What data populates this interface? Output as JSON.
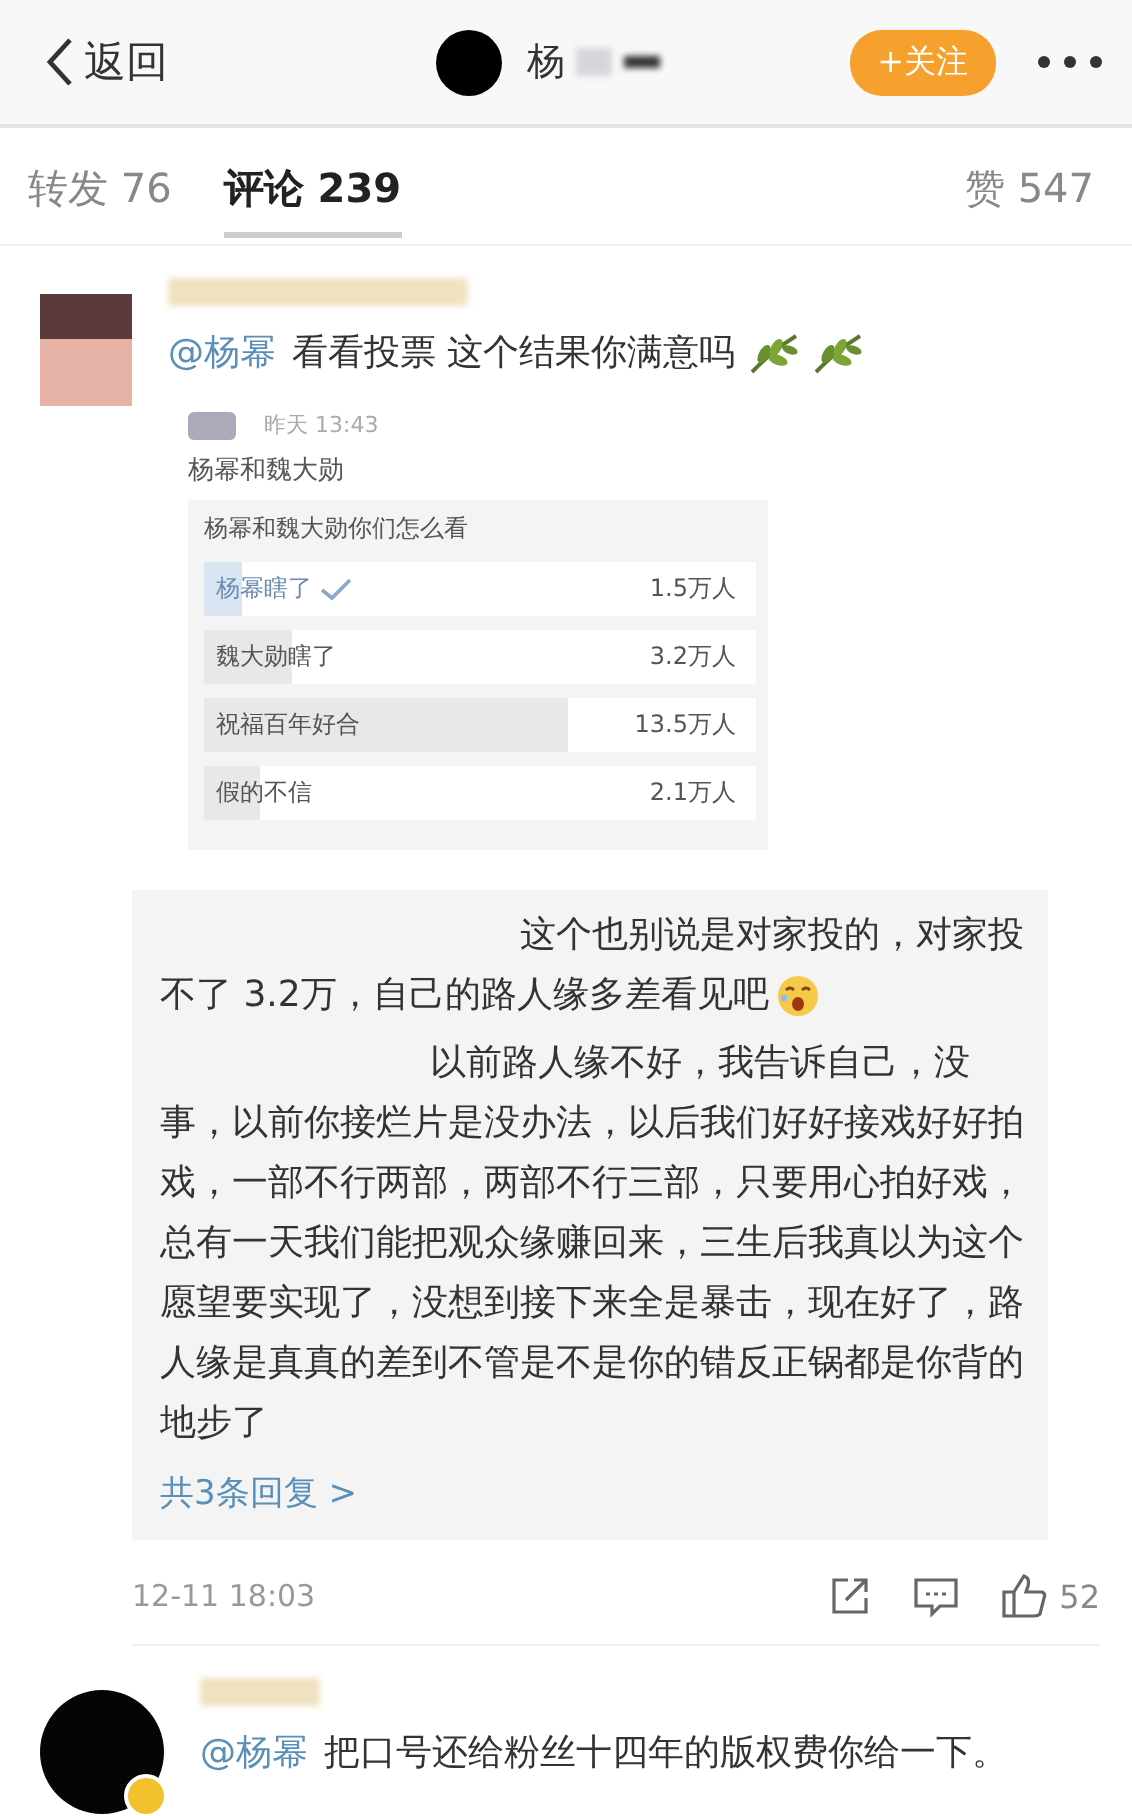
{
  "header": {
    "back": "返回",
    "account_name": "杨",
    "follow_button": "+关注"
  },
  "tabs": [
    {
      "label": "转发 76",
      "selected": false
    },
    {
      "label": "评论 239",
      "selected": true
    }
  ],
  "likes_tab": "赞 547",
  "comments": [
    {
      "mention": "@杨幂",
      "text": "看看投票 这个结果你满意吗",
      "embedded_post": {
        "time": "昨天 13:43",
        "title": "杨幂和魏大勋",
        "poll": {
          "question": "杨幂和魏大勋你们怎么看",
          "options": [
            {
              "label": "杨幂瞎了",
              "count": "1.5万人",
              "level": 0.07,
              "selected": true
            },
            {
              "label": "魏大勋瞎了",
              "count": "3.2万人",
              "level": 0.16,
              "selected": false
            },
            {
              "label": "祝福百年好合",
              "count": "13.5万人",
              "level": 0.66,
              "selected": false
            },
            {
              "label": "假的不信",
              "count": "2.1万人",
              "level": 0.1,
              "selected": false
            }
          ]
        }
      },
      "replies": [
        {
          "text": "这个也别说是对家投的，对家投不了 3.2万，自己的路人缘多差看见吧"
        },
        {
          "text": "以前路人缘不好，我告诉自己，没事，以前你接烂片是没办法，以后我们好好接戏好好拍戏，一部不行两部，两部不行三部，只要用心拍好戏，总有一天我们能把观众缘赚回来，三生后我真以为这个愿望要实现了，没想到接下来全是暴击，现在好了，路人缘是真真的差到不管是不是你的错反正锅都是你背的地步了"
        }
      ],
      "replies_link": "共3条回复 >",
      "time": "12-11 18:03",
      "like_count": "52"
    },
    {
      "mention": "@杨幂",
      "text": "把口号还给粉丝十四年的版权费你给一下。",
      "verified": true
    }
  ]
}
